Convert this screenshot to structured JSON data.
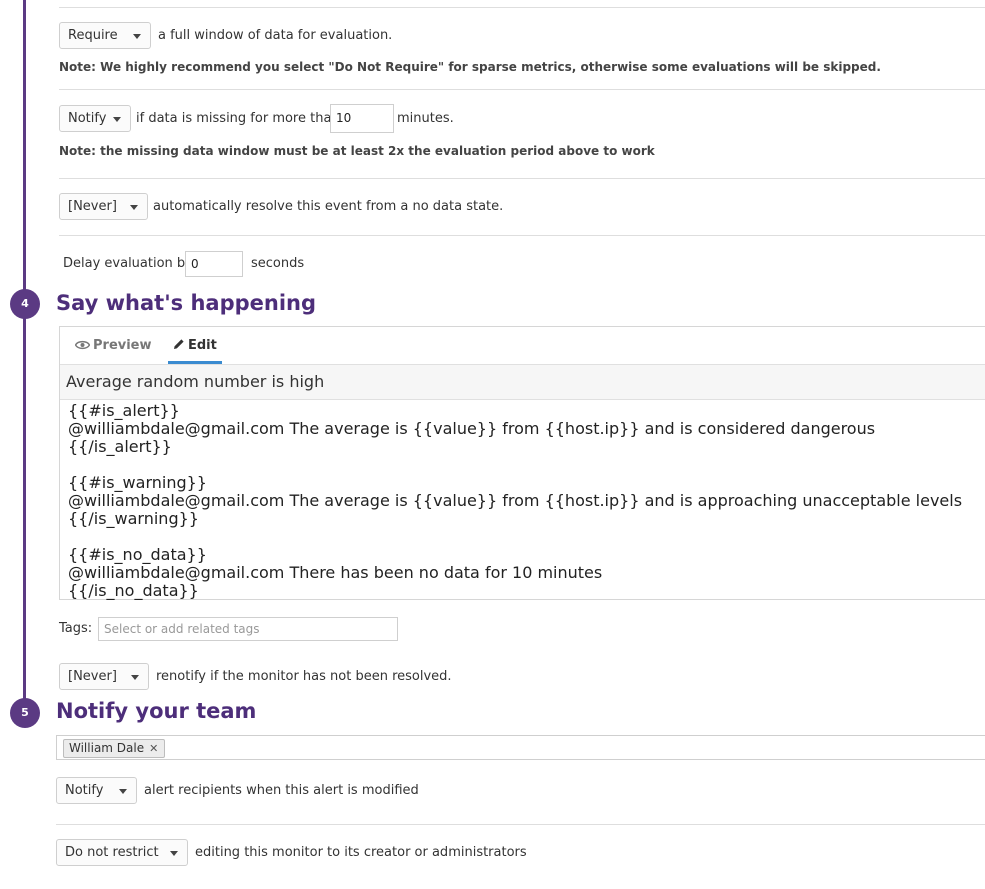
{
  "evaluation": {
    "require_select": "Require",
    "require_text": "a full window of data for evaluation.",
    "require_note": "Note: We highly recommend you select \"Do Not Require\" for sparse metrics, otherwise some evaluations will be skipped."
  },
  "missing_data": {
    "notify_select": "Notify",
    "text_before": "if data is missing for more than",
    "minutes_value": "10",
    "text_after": "minutes.",
    "note": "Note: the missing data window must be at least 2x the evaluation period above to work"
  },
  "auto_resolve": {
    "select": "[Never]",
    "text": "automatically resolve this event from a no data state."
  },
  "delay": {
    "label": "Delay evaluation by",
    "value": "0",
    "unit": "seconds"
  },
  "step4": {
    "number": "4",
    "title": "Say what's happening",
    "tabs": {
      "preview": "Preview",
      "edit": "Edit"
    },
    "message_title": "Average random number is high",
    "message_lines": [
      "{{#is_alert}}",
      "@williambdale@gmail.com The average is {{value}} from {{host.ip}} and is considered dangerous",
      "{{/is_alert}}",
      "",
      "{{#is_warning}}",
      "@williambdale@gmail.com The average is {{value}} from {{host.ip}} and is approaching unacceptable levels",
      "{{/is_warning}}",
      "",
      "{{#is_no_data}}",
      "@williambdale@gmail.com There has been no data for 10 minutes",
      "{{/is_no_data}}"
    ],
    "tags_label": "Tags:",
    "tags_placeholder": "Select or add related tags",
    "renotify_select": "[Never]",
    "renotify_text": "renotify if the monitor has not been resolved."
  },
  "step5": {
    "number": "5",
    "title": "Notify your team",
    "recipient": "William Dale",
    "notify_select": "Notify",
    "notify_text": "alert recipients when this alert is modified",
    "restrict_select": "Do not restrict",
    "restrict_text": "editing this monitor to its creator or administrators"
  },
  "colors": {
    "accent_purple": "#5b3a83",
    "heading_purple": "#4d2e7a",
    "tab_underline": "#3a8bd0"
  }
}
